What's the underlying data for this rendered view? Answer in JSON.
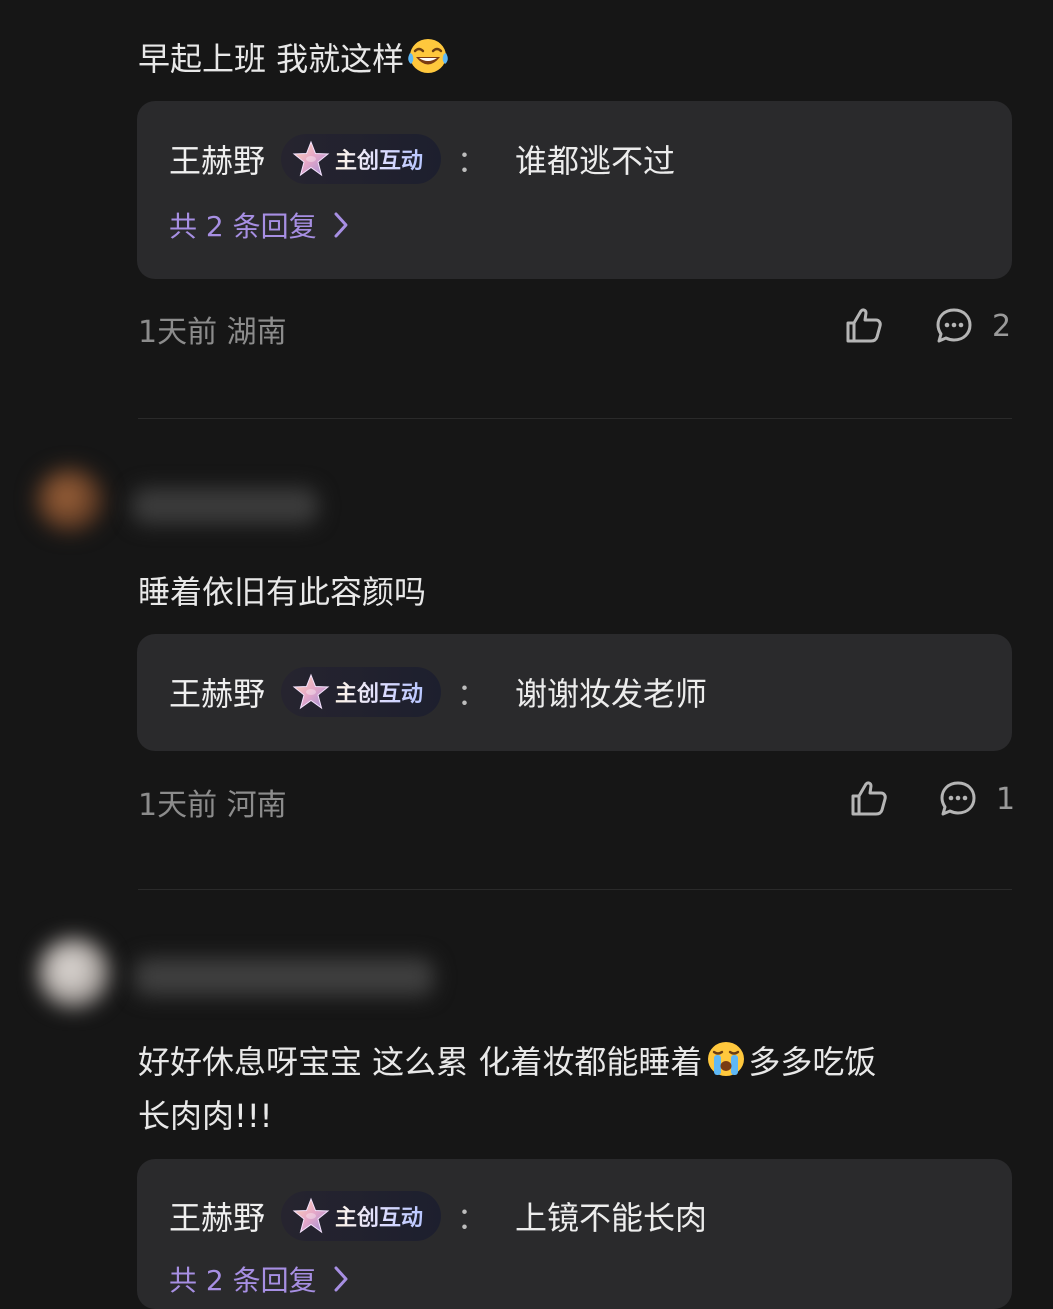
{
  "comments": [
    {
      "text": "早起上班 我就这样",
      "emoji_icon": "laughing-tears-emoji",
      "reply": {
        "author": "王赫野",
        "badge": "主创互动",
        "colon": "：",
        "text": "谁都逃不过"
      },
      "more_replies": "共 2 条回复",
      "time": "1天前",
      "location": "湖南",
      "reply_count": "2"
    },
    {
      "text": "睡着依旧有此容颜吗",
      "reply": {
        "author": "王赫野",
        "badge": "主创互动",
        "colon": "：",
        "text": "谢谢妆发老师"
      },
      "time": "1天前",
      "location": "河南",
      "reply_count": "1"
    },
    {
      "text_line1_part1": "好好休息呀宝宝 这么累 化着妆都能睡着",
      "emoji_icon": "crying-emoji",
      "text_line1_part2": "多多吃饭",
      "text_line2": "长肉肉!!!",
      "reply": {
        "author": "王赫野",
        "badge": "主创互动",
        "colon": "：",
        "text": "上镜不能长肉"
      },
      "more_replies": "共 2 条回复"
    }
  ],
  "icons": {
    "like": "thumbs-up-icon",
    "reply": "comment-bubble-icon",
    "chevron": "chevron-right-icon",
    "badge": "star-badge-icon"
  },
  "colors": {
    "background": "#161616",
    "reply_box": "#2a2a2c",
    "accent_purple": "#a78fe3",
    "meta_gray": "#8c8c8c"
  }
}
